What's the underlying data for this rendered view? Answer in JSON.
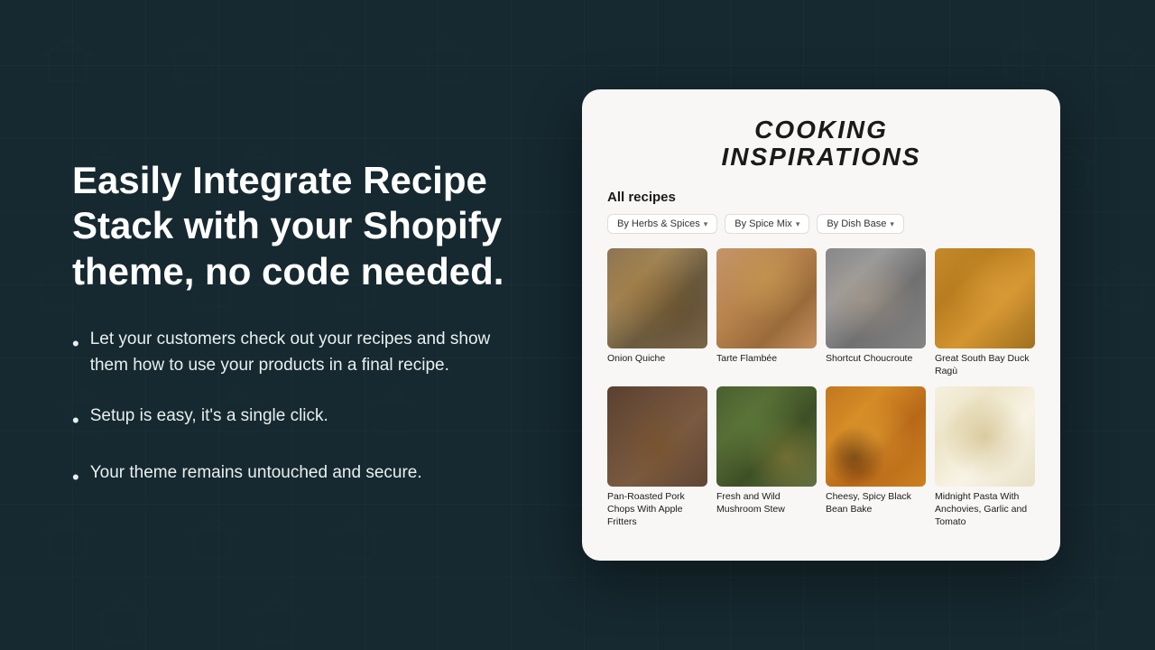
{
  "background": {
    "color": "#162830"
  },
  "left": {
    "heading": "Easily Integrate Recipe Stack with your Shopify theme, no code needed.",
    "bullets": [
      {
        "id": "bullet-1",
        "text": "Let your customers check out your recipes and show them how to use your products in a final recipe."
      },
      {
        "id": "bullet-2",
        "text": "Setup is easy, it's a single click."
      },
      {
        "id": "bullet-3",
        "text": "Your theme remains untouched and secure."
      }
    ]
  },
  "right": {
    "site_title_line1": "COOKING",
    "site_title_line2": "INSPIRATIONS",
    "recipes_label": "All recipes",
    "filters": [
      {
        "id": "filter-herbs",
        "label": "By Herbs & Spices"
      },
      {
        "id": "filter-spice",
        "label": "By Spice Mix"
      },
      {
        "id": "filter-dish",
        "label": "By Dish Base"
      }
    ],
    "recipes": [
      {
        "id": "recipe-1",
        "name": "Onion Quiche",
        "food_class": "food-onion-quiche"
      },
      {
        "id": "recipe-2",
        "name": "Tarte Flambée",
        "food_class": "food-tarte-flambee"
      },
      {
        "id": "recipe-3",
        "name": "Shortcut Choucroute",
        "food_class": "food-shortcut-choucroute"
      },
      {
        "id": "recipe-4",
        "name": "Great South Bay Duck Ragù",
        "food_class": "food-duck-ragu"
      },
      {
        "id": "recipe-5",
        "name": "Pan-Roasted Pork Chops With Apple Fritters",
        "food_class": "food-pork-chops"
      },
      {
        "id": "recipe-6",
        "name": "Fresh and Wild Mushroom Stew",
        "food_class": "food-mushroom-stew"
      },
      {
        "id": "recipe-7",
        "name": "Cheesy, Spicy Black Bean Bake",
        "food_class": "food-black-bean"
      },
      {
        "id": "recipe-8",
        "name": "Midnight Pasta With Anchovies, Garlic and Tomato",
        "food_class": "food-midnight-pasta"
      }
    ]
  }
}
